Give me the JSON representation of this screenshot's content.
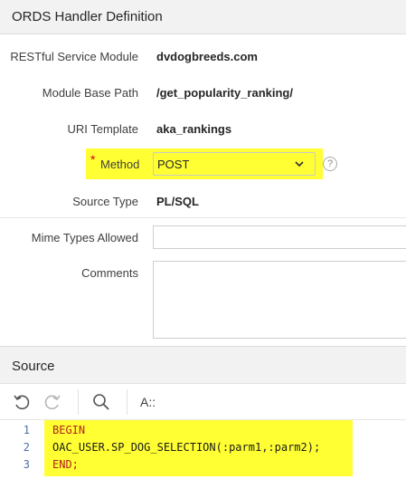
{
  "region": {
    "title": "ORDS Handler Definition"
  },
  "form": {
    "module_label": "RESTful Service Module",
    "module_value": "dvdogbreeds.com",
    "base_path_label": "Module Base Path",
    "base_path_value": "/get_popularity_ranking/",
    "uri_label": "URI Template",
    "uri_value": "aka_rankings",
    "method_required": "*",
    "method_label": "Method",
    "method_value": "POST",
    "method_help": "?",
    "source_type_label": "Source Type",
    "source_type_value": "PL/SQL",
    "mime_label": "Mime Types Allowed",
    "mime_value": "",
    "comments_label": "Comments",
    "comments_value": ""
  },
  "source": {
    "title": "Source",
    "toolbar": {
      "undo_icon": "undo-icon",
      "redo_icon": "redo-icon",
      "search_icon": "search-icon",
      "font_label": "A::"
    },
    "lines": [
      {
        "num": "1",
        "text": "BEGIN"
      },
      {
        "num": "2",
        "text": "OAC_USER.SP_DOG_SELECTION(:parm1,:parm2);"
      },
      {
        "num": "3",
        "text": "END;"
      }
    ]
  },
  "colors": {
    "highlight": "#ffff33",
    "keyword": "#b22222",
    "line_number": "#4a6fa5"
  }
}
